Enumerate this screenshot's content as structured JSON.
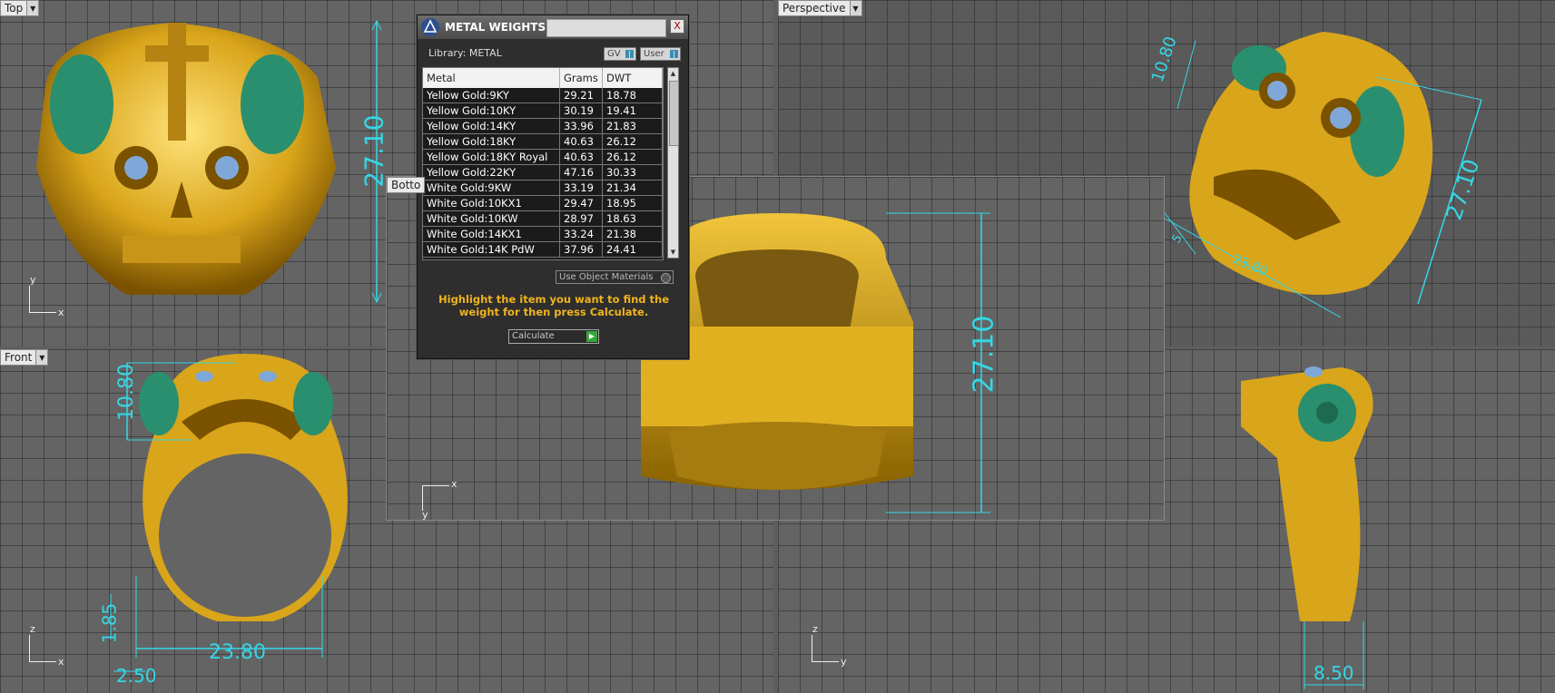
{
  "viewports": {
    "top": {
      "label": "Top",
      "axis_h": "x",
      "axis_v": "y"
    },
    "front": {
      "label": "Front",
      "axis_h": "x",
      "axis_v": "z"
    },
    "perspective": {
      "label": "Perspective"
    },
    "bottom": {
      "label": "Botto",
      "axis_h": "x",
      "axis_v": "y"
    },
    "right": {
      "axis_h": "y",
      "axis_v": "z"
    }
  },
  "dimensions": {
    "top_height": "27.10",
    "front_top": "10.80",
    "front_band": "1.85",
    "front_width": "23.80",
    "front_min": "2.50",
    "persp_top": "10.80",
    "persp_side": "27.10",
    "persp_width": "23.80",
    "persp_small": "5",
    "bottom_height": "27.10",
    "right_width": "8.50"
  },
  "panel": {
    "title": "METAL WEIGHTS",
    "close_label": "X",
    "library_label": "Library: METAL",
    "toggle_gv": "GV",
    "toggle_user": "User",
    "columns": [
      "Metal",
      "Grams",
      "DWT"
    ],
    "rows": [
      [
        "Yellow Gold:9KY",
        "29.21",
        "18.78"
      ],
      [
        "Yellow Gold:10KY",
        "30.19",
        "19.41"
      ],
      [
        "Yellow Gold:14KY",
        "33.96",
        "21.83"
      ],
      [
        "Yellow Gold:18KY",
        "40.63",
        "26.12"
      ],
      [
        "Yellow Gold:18KY Royal",
        "40.63",
        "26.12"
      ],
      [
        "Yellow Gold:22KY",
        "47.16",
        "30.33"
      ],
      [
        "White Gold:9KW",
        "33.19",
        "21.34"
      ],
      [
        "White Gold:10KX1",
        "29.47",
        "18.95"
      ],
      [
        "White Gold:10KW",
        "28.97",
        "18.63"
      ],
      [
        "White Gold:14KX1",
        "33.24",
        "21.38"
      ],
      [
        "White Gold:14K PdW",
        "37.96",
        "24.41"
      ]
    ],
    "use_object_materials": "Use Object Materials",
    "hint": "Highlight the item you want to find the weight for then press Calculate.",
    "calculate_label": "Calculate"
  },
  "colors": {
    "dimension": "#35d6e6",
    "gold": "#e0b020",
    "enamel": "#2a8f6e",
    "gem": "#7fa8d8",
    "hint": "#f0b41d"
  }
}
